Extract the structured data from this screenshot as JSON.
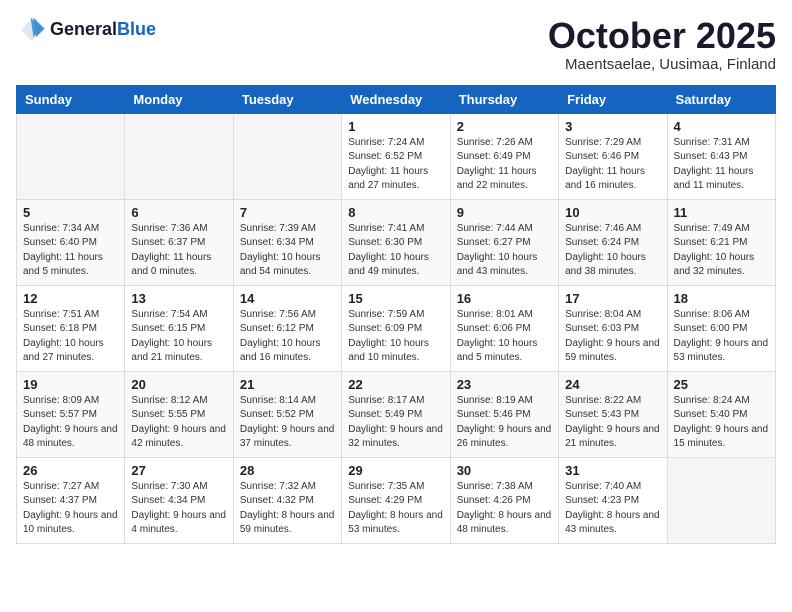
{
  "logo": {
    "general": "General",
    "blue": "Blue"
  },
  "title": "October 2025",
  "subtitle": "Maentsaelae, Uusimaa, Finland",
  "days_of_week": [
    "Sunday",
    "Monday",
    "Tuesday",
    "Wednesday",
    "Thursday",
    "Friday",
    "Saturday"
  ],
  "weeks": [
    [
      {
        "day": "",
        "info": ""
      },
      {
        "day": "",
        "info": ""
      },
      {
        "day": "",
        "info": ""
      },
      {
        "day": "1",
        "info": "Sunrise: 7:24 AM\nSunset: 6:52 PM\nDaylight: 11 hours and 27 minutes."
      },
      {
        "day": "2",
        "info": "Sunrise: 7:26 AM\nSunset: 6:49 PM\nDaylight: 11 hours and 22 minutes."
      },
      {
        "day": "3",
        "info": "Sunrise: 7:29 AM\nSunset: 6:46 PM\nDaylight: 11 hours and 16 minutes."
      },
      {
        "day": "4",
        "info": "Sunrise: 7:31 AM\nSunset: 6:43 PM\nDaylight: 11 hours and 11 minutes."
      }
    ],
    [
      {
        "day": "5",
        "info": "Sunrise: 7:34 AM\nSunset: 6:40 PM\nDaylight: 11 hours and 5 minutes."
      },
      {
        "day": "6",
        "info": "Sunrise: 7:36 AM\nSunset: 6:37 PM\nDaylight: 11 hours and 0 minutes."
      },
      {
        "day": "7",
        "info": "Sunrise: 7:39 AM\nSunset: 6:34 PM\nDaylight: 10 hours and 54 minutes."
      },
      {
        "day": "8",
        "info": "Sunrise: 7:41 AM\nSunset: 6:30 PM\nDaylight: 10 hours and 49 minutes."
      },
      {
        "day": "9",
        "info": "Sunrise: 7:44 AM\nSunset: 6:27 PM\nDaylight: 10 hours and 43 minutes."
      },
      {
        "day": "10",
        "info": "Sunrise: 7:46 AM\nSunset: 6:24 PM\nDaylight: 10 hours and 38 minutes."
      },
      {
        "day": "11",
        "info": "Sunrise: 7:49 AM\nSunset: 6:21 PM\nDaylight: 10 hours and 32 minutes."
      }
    ],
    [
      {
        "day": "12",
        "info": "Sunrise: 7:51 AM\nSunset: 6:18 PM\nDaylight: 10 hours and 27 minutes."
      },
      {
        "day": "13",
        "info": "Sunrise: 7:54 AM\nSunset: 6:15 PM\nDaylight: 10 hours and 21 minutes."
      },
      {
        "day": "14",
        "info": "Sunrise: 7:56 AM\nSunset: 6:12 PM\nDaylight: 10 hours and 16 minutes."
      },
      {
        "day": "15",
        "info": "Sunrise: 7:59 AM\nSunset: 6:09 PM\nDaylight: 10 hours and 10 minutes."
      },
      {
        "day": "16",
        "info": "Sunrise: 8:01 AM\nSunset: 6:06 PM\nDaylight: 10 hours and 5 minutes."
      },
      {
        "day": "17",
        "info": "Sunrise: 8:04 AM\nSunset: 6:03 PM\nDaylight: 9 hours and 59 minutes."
      },
      {
        "day": "18",
        "info": "Sunrise: 8:06 AM\nSunset: 6:00 PM\nDaylight: 9 hours and 53 minutes."
      }
    ],
    [
      {
        "day": "19",
        "info": "Sunrise: 8:09 AM\nSunset: 5:57 PM\nDaylight: 9 hours and 48 minutes."
      },
      {
        "day": "20",
        "info": "Sunrise: 8:12 AM\nSunset: 5:55 PM\nDaylight: 9 hours and 42 minutes."
      },
      {
        "day": "21",
        "info": "Sunrise: 8:14 AM\nSunset: 5:52 PM\nDaylight: 9 hours and 37 minutes."
      },
      {
        "day": "22",
        "info": "Sunrise: 8:17 AM\nSunset: 5:49 PM\nDaylight: 9 hours and 32 minutes."
      },
      {
        "day": "23",
        "info": "Sunrise: 8:19 AM\nSunset: 5:46 PM\nDaylight: 9 hours and 26 minutes."
      },
      {
        "day": "24",
        "info": "Sunrise: 8:22 AM\nSunset: 5:43 PM\nDaylight: 9 hours and 21 minutes."
      },
      {
        "day": "25",
        "info": "Sunrise: 8:24 AM\nSunset: 5:40 PM\nDaylight: 9 hours and 15 minutes."
      }
    ],
    [
      {
        "day": "26",
        "info": "Sunrise: 7:27 AM\nSunset: 4:37 PM\nDaylight: 9 hours and 10 minutes."
      },
      {
        "day": "27",
        "info": "Sunrise: 7:30 AM\nSunset: 4:34 PM\nDaylight: 9 hours and 4 minutes."
      },
      {
        "day": "28",
        "info": "Sunrise: 7:32 AM\nSunset: 4:32 PM\nDaylight: 8 hours and 59 minutes."
      },
      {
        "day": "29",
        "info": "Sunrise: 7:35 AM\nSunset: 4:29 PM\nDaylight: 8 hours and 53 minutes."
      },
      {
        "day": "30",
        "info": "Sunrise: 7:38 AM\nSunset: 4:26 PM\nDaylight: 8 hours and 48 minutes."
      },
      {
        "day": "31",
        "info": "Sunrise: 7:40 AM\nSunset: 4:23 PM\nDaylight: 8 hours and 43 minutes."
      },
      {
        "day": "",
        "info": ""
      }
    ]
  ]
}
